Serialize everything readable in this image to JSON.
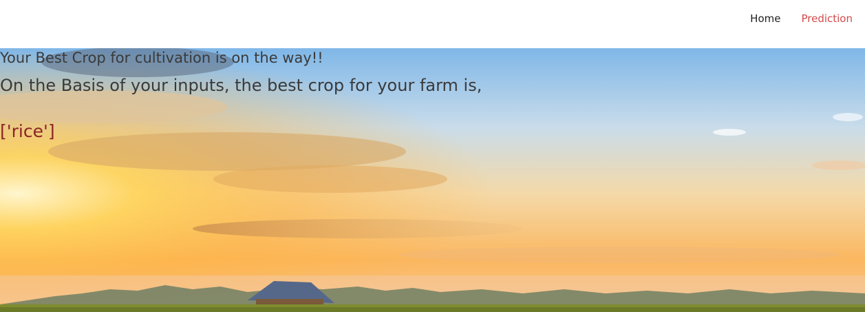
{
  "nav": {
    "items": [
      {
        "label": "Home"
      },
      {
        "label": "Prediction"
      }
    ],
    "active_color": "#d24a4a"
  },
  "hero": {
    "headline": "Your Best Crop for cultivation is on the way!!",
    "subheadline": "On the Basis of your inputs, the best crop for your farm is,",
    "result": "['rice']",
    "result_color": "#8b2424",
    "background": "sunset-farm-field"
  }
}
